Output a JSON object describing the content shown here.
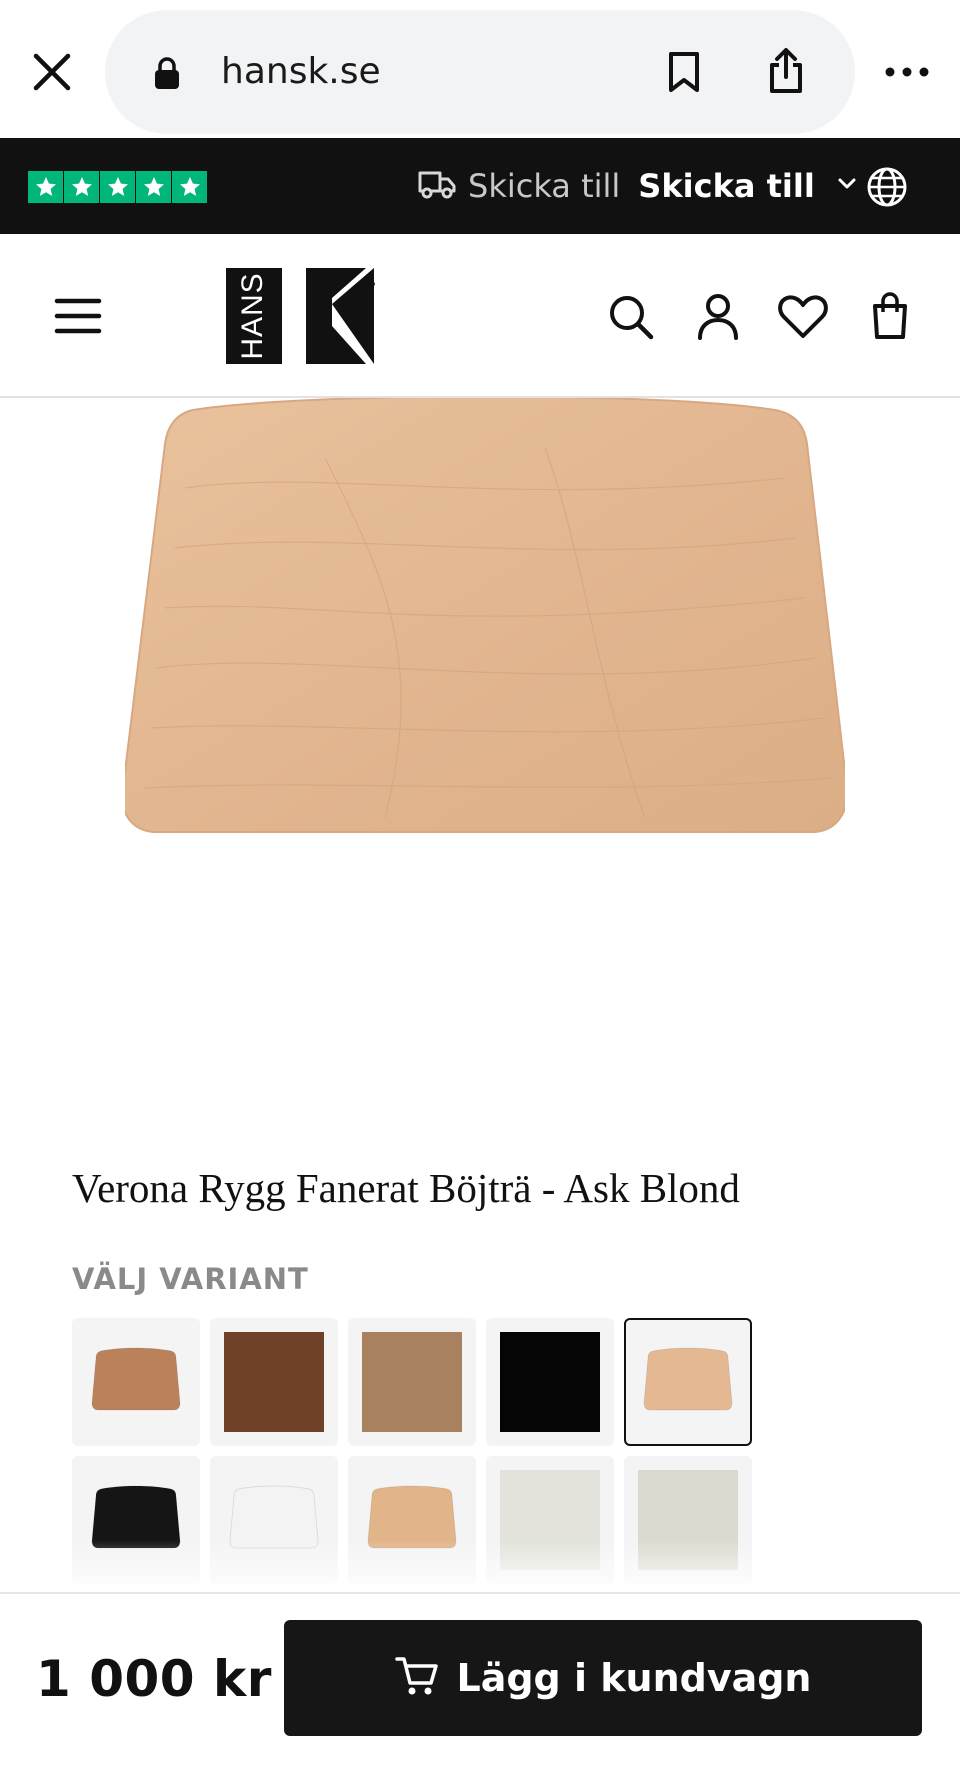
{
  "browser": {
    "url": "hansk.se",
    "close_icon": "close-icon",
    "lock_icon": "lock-icon",
    "bookmark_icon": "bookmark-icon",
    "share_icon": "share-icon",
    "more_icon": "more-icon"
  },
  "promo_bar": {
    "rating_stars": 5,
    "ship_muted_label": "Skicka till",
    "ship_label": "Skicka till",
    "truck_icon": "truck-icon",
    "chevron_icon": "chevron-down-icon",
    "globe_icon": "globe-icon"
  },
  "header": {
    "logo_text": "HANS K",
    "menu_icon": "menu-icon",
    "search_icon": "search-icon",
    "account_icon": "account-icon",
    "wishlist_icon": "heart-icon",
    "bag_icon": "bag-icon"
  },
  "product": {
    "title": "Verona Rygg Fanerat Böjträ - Ask Blond",
    "variant_heading": "VÄLJ VARIANT",
    "variants": [
      {
        "kind": "seat",
        "color": "#b9825a",
        "selected": false
      },
      {
        "kind": "square",
        "color": "#6e4128",
        "selected": false
      },
      {
        "kind": "square",
        "color": "#a8825f",
        "selected": false
      },
      {
        "kind": "square",
        "color": "#050505",
        "selected": false
      },
      {
        "kind": "seat",
        "color": "#e3b892",
        "selected": true
      },
      {
        "kind": "seat",
        "color": "#151515",
        "selected": false
      },
      {
        "kind": "seat",
        "color": "#f3f3f3",
        "selected": false
      },
      {
        "kind": "seat",
        "color": "#e1b48a",
        "selected": false
      },
      {
        "kind": "square",
        "color": "#e3e3dc",
        "selected": false
      },
      {
        "kind": "square",
        "color": "#dcdad0",
        "selected": false
      }
    ]
  },
  "bottom_bar": {
    "price": "1 000 kr",
    "cart_label": "Lägg i kundvagn",
    "cart_icon": "cart-icon"
  }
}
